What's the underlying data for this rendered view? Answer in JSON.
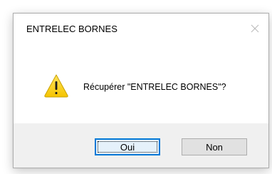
{
  "dialog": {
    "title": "ENTRELEC BORNES",
    "close_icon": "close-icon",
    "message": "Récupérer \"ENTRELEC BORNES\"?",
    "icon": "warning-icon",
    "buttons": {
      "yes_label": "Oui",
      "no_label": "Non"
    }
  },
  "colors": {
    "accent": "#0078d7",
    "footer_bg": "#f0f0f0",
    "warning_yellow": "#fcd116"
  }
}
